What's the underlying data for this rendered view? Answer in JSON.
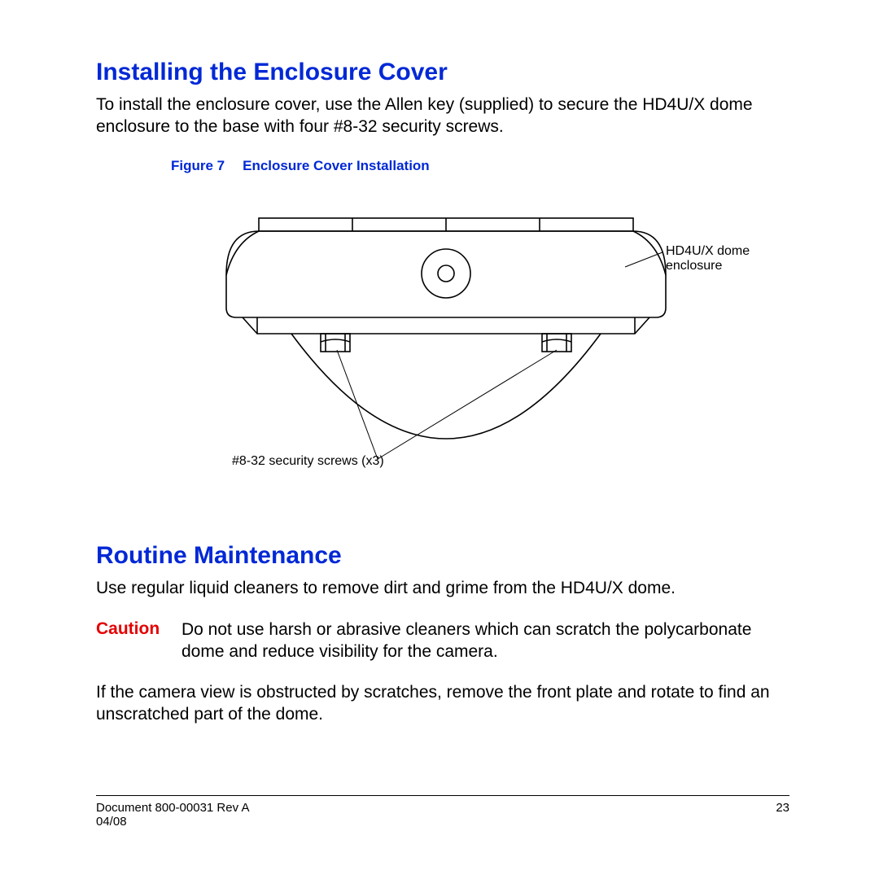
{
  "section1": {
    "heading": "Installing the Enclosure Cover",
    "para": "To install the enclosure cover, use the Allen key (supplied) to secure the HD4U/X dome enclosure to the base with four #8-32 security screws."
  },
  "figure": {
    "label_prefix": "Figure 7",
    "label_title": "Enclosure Cover Installation",
    "callout_right": "HD4U/X dome enclosure",
    "callout_left": "#8-32 security screws (x3)"
  },
  "section2": {
    "heading": "Routine Maintenance",
    "para1": "Use regular liquid cleaners to remove dirt and grime from the HD4U/X dome.",
    "caution_label": "Caution",
    "caution_body": "Do not use harsh or abrasive cleaners which can scratch the polycarbonate dome and reduce visibility for the camera.",
    "para2": "If the camera view is obstructed by scratches, remove the front plate and rotate to find an unscratched part of the dome."
  },
  "footer": {
    "doc": "Document 800-00031 Rev A",
    "page": "23",
    "date": "04/08"
  }
}
